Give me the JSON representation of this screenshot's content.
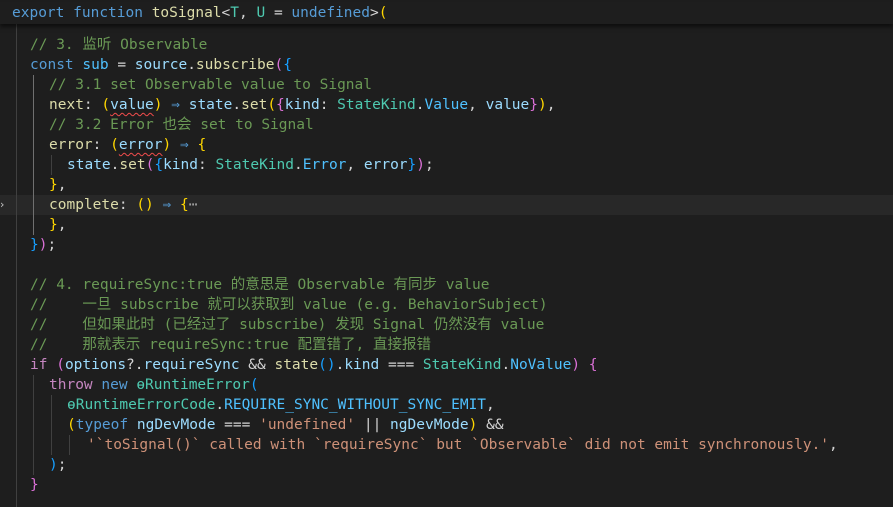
{
  "editor": {
    "sticky": {
      "kw_export": "export",
      "kw_function": "function",
      "fn_name": "toSignal",
      "lt": "<",
      "tp_t": "T",
      "comma": ", ",
      "tp_u": "U",
      "eq": " = ",
      "kw_undefined": "undefined",
      "gt": ">",
      "paren": "("
    },
    "l1": {
      "comment": "// 3. 监听 Observable"
    },
    "l2": {
      "kw_const": "const",
      "sub": "sub",
      "eq": " = ",
      "source": "source",
      "dot": ".",
      "subscribe": "subscribe",
      "paren": "(",
      "brace": "{"
    },
    "l3": {
      "comment": "// 3.1 set Observable value to Signal"
    },
    "l4": {
      "next": "next",
      "colon": ": ",
      "po": "(",
      "value": "value",
      "pc": ")",
      "arrow": " ⇒ ",
      "state": "state",
      "dot": ".",
      "set": "set",
      "paren": "(",
      "bo": "{",
      "kind": "kind",
      "colon2": ": ",
      "statekind": "StateKind",
      "dot2": ".",
      "member": "Value",
      "comma": ", ",
      "value2": "value",
      "bc": "}",
      "pclose": ")",
      "end": ","
    },
    "l5": {
      "comment": "// 3.2 Error 也会 set to Signal"
    },
    "l6": {
      "error": "error",
      "colon": ": ",
      "po": "(",
      "param": "error",
      "pc": ")",
      "arrow": " ⇒ ",
      "brace": "{"
    },
    "l7": {
      "state": "state",
      "dot": ".",
      "set": "set",
      "paren": "(",
      "bo": "{",
      "kind": "kind",
      "colon": ": ",
      "statekind": "StateKind",
      "dot2": ".",
      "member": "Error",
      "comma": ", ",
      "err": "error",
      "bc": "}",
      "pclose": ")",
      "end": ";"
    },
    "l8": {
      "brace": "}",
      "end": ","
    },
    "l9": {
      "complete": "complete",
      "colon": ": ",
      "parens": "()",
      "arrow": " ⇒ ",
      "brace": "{",
      "ellipsis": "⋯"
    },
    "l10": {
      "brace": "}",
      "end": ","
    },
    "l11": {
      "brace": "}",
      "paren": ")",
      "end": ";"
    },
    "l13": {
      "comment": "// 4. requireSync:true 的意思是 Observable 有同步 value"
    },
    "l14": {
      "comment": "//    一旦 subscribe 就可以获取到 value (e.g. BehaviorSubject)"
    },
    "l15": {
      "comment": "//    但如果此时 (已经过了 subscribe) 发现 Signal 仍然没有 value"
    },
    "l16": {
      "comment": "//    那就表示 requireSync:true 配置错了, 直接报错"
    },
    "l17": {
      "kw_if": "if",
      "po": " (",
      "options": "options",
      "opt": "?.",
      "reqsync": "requireSync",
      "and": " && ",
      "state": "state",
      "call": "()",
      "dot": ".",
      "kind": "kind",
      "eq3": " === ",
      "statekind": "StateKind",
      "dot2": ".",
      "member": "NoValue",
      "pc": ")",
      "brace": " {"
    },
    "l18": {
      "kw_throw": "throw",
      "kw_new": " new ",
      "cls": "ɵRuntimeError",
      "paren": "("
    },
    "l19": {
      "code": "ɵRuntimeErrorCode",
      "dot": ".",
      "member": "REQUIRE_SYNC_WITHOUT_SYNC_EMIT",
      "end": ","
    },
    "l20": {
      "po": "(",
      "kw_typeof": "typeof",
      "sp": " ",
      "devmode": "ngDevMode",
      "eq3": " === ",
      "str": "'undefined'",
      "or": " || ",
      "devmode2": "ngDevMode",
      "pc": ")",
      "and": " &&"
    },
    "l21": {
      "str": "'`toSignal()` called with `requireSync` but `Observable` did not emit synchronously.'",
      "end": ","
    },
    "l22": {
      "pc": ")",
      "end": ";"
    },
    "l23": {
      "brace": "}"
    }
  }
}
